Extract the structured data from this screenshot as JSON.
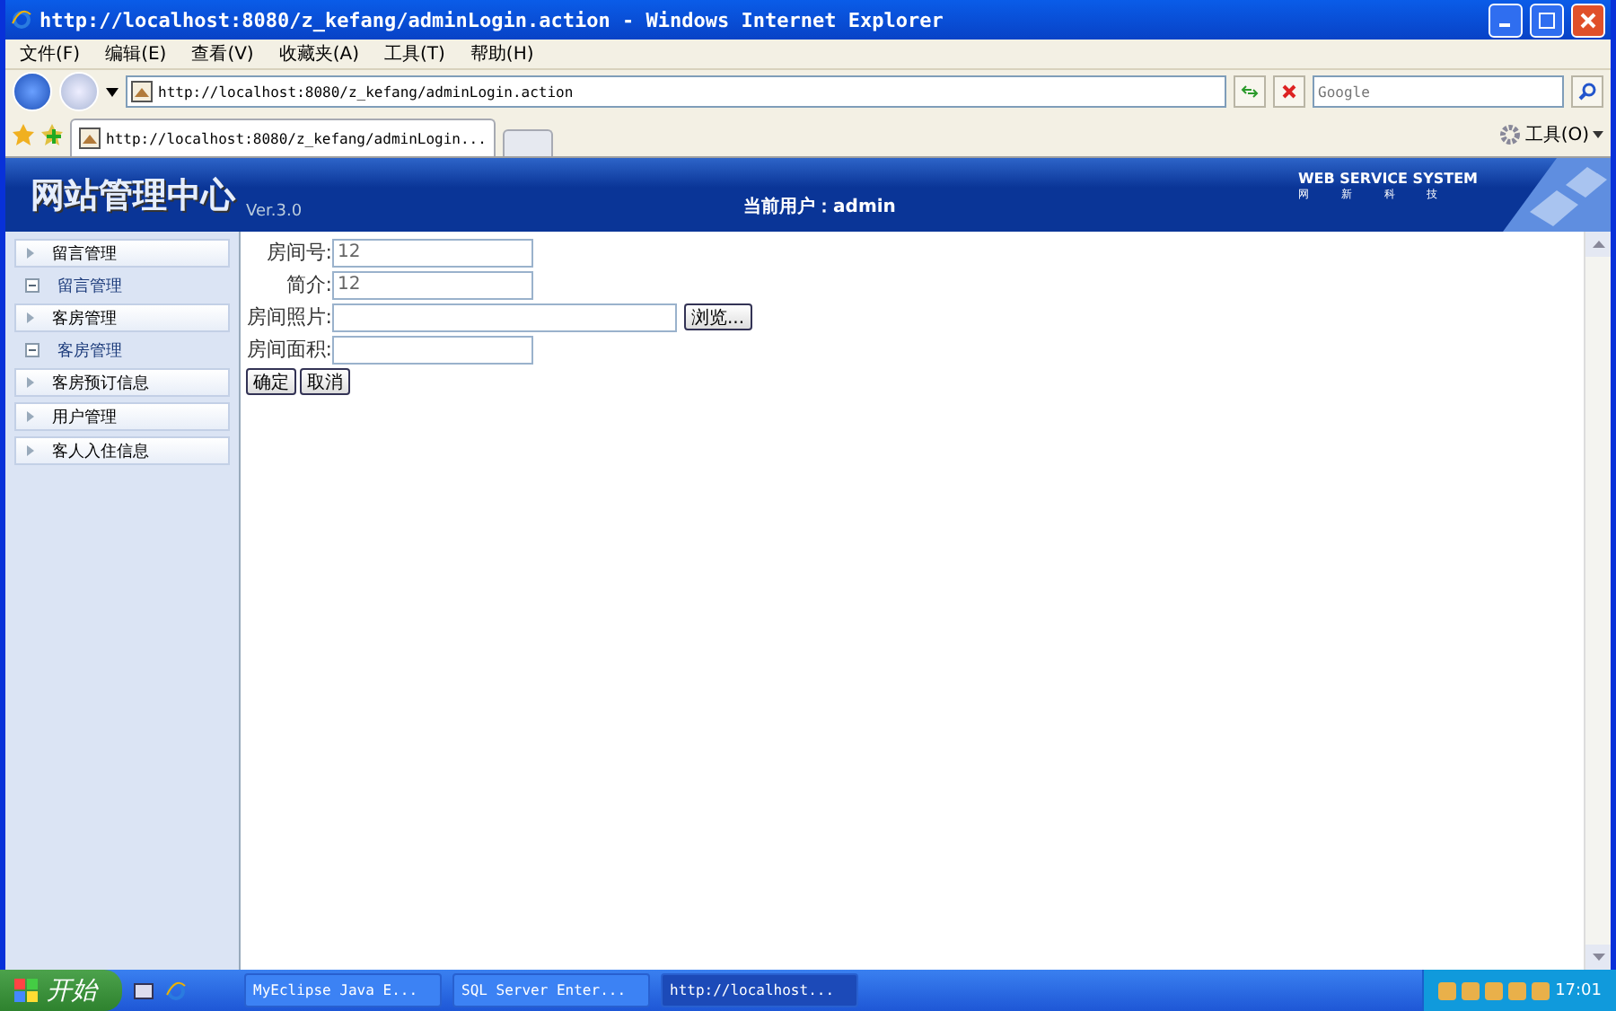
{
  "window": {
    "title": "http://localhost:8080/z_kefang/adminLogin.action - Windows Internet Explorer"
  },
  "menu": [
    "文件(F)",
    "编辑(E)",
    "查看(V)",
    "收藏夹(A)",
    "工具(T)",
    "帮助(H)"
  ],
  "address": {
    "value": "http://localhost:8080/z_kefang/adminLogin.action"
  },
  "search": {
    "placeholder": "Google"
  },
  "tabs": [
    {
      "label": "http://localhost:8080/z_kefang/adminLogin...",
      "selected": true
    }
  ],
  "tools_label": "工具(O)",
  "banner": {
    "title": "网站管理中心",
    "version": "Ver.3.0",
    "user_label": "当前用户：",
    "user": "admin",
    "brand": "WEB SERVICE SYSTEM",
    "brand_sub": "网 新 科 技"
  },
  "sidebar": {
    "items": [
      {
        "kind": "header",
        "label": "留言管理"
      },
      {
        "kind": "sub",
        "label": "留言管理"
      },
      {
        "kind": "header",
        "label": "客房管理"
      },
      {
        "kind": "sub",
        "label": "客房管理"
      },
      {
        "kind": "header",
        "label": "客房预订信息"
      },
      {
        "kind": "header",
        "label": "用户管理"
      },
      {
        "kind": "header",
        "label": "客人入住信息"
      }
    ]
  },
  "form": {
    "fields": [
      {
        "kind": "text",
        "label": "房间号:",
        "value": "12"
      },
      {
        "kind": "text",
        "label": "简介:",
        "value": "12"
      },
      {
        "kind": "file",
        "label": "房间照片:",
        "button": "浏览..."
      },
      {
        "kind": "text",
        "label": "房间面积:"
      }
    ],
    "buttons": [
      "确定",
      "取消"
    ]
  },
  "taskbar": {
    "start": "开始",
    "tasks": [
      {
        "label": "MyEclipse Java E...",
        "selected": false
      },
      {
        "label": "SQL Server Enter...",
        "selected": false
      },
      {
        "label": "http://localhost...",
        "selected": true
      }
    ],
    "clock": "17:01"
  }
}
